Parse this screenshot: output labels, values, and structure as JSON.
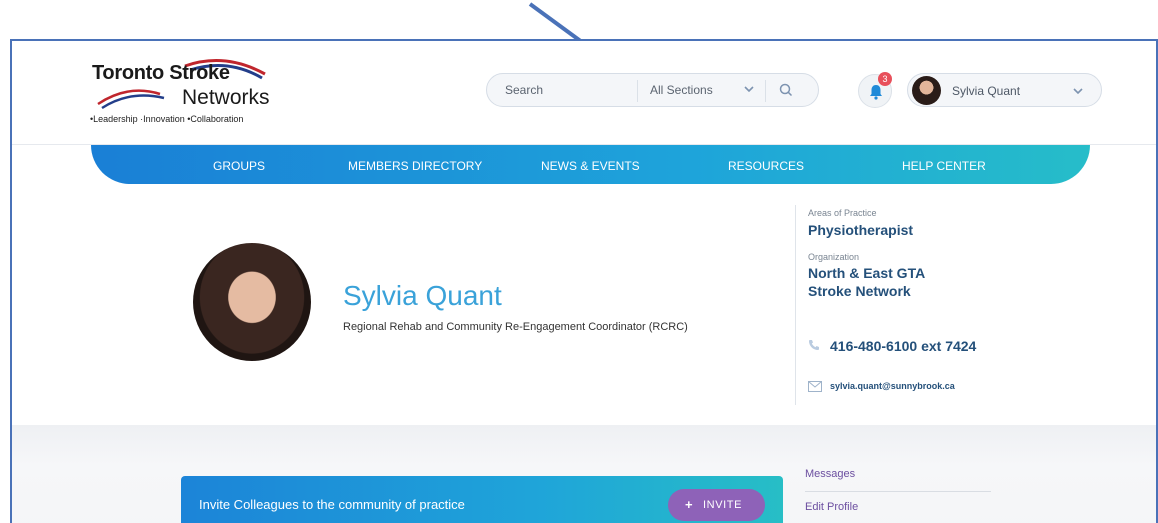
{
  "header": {
    "logo": {
      "line1": "Toronto Stroke",
      "line2": "Networks",
      "tagline": "•Leadership  ·Innovation  •Collaboration"
    },
    "search": {
      "placeholder": "Search",
      "section_value": "All Sections",
      "search_icon": "search-icon",
      "chevron_icon": "chevron-down-icon"
    },
    "notifications": {
      "icon": "bell-icon",
      "count": "3",
      "badge_color": "#e8505b"
    },
    "user": {
      "name": "Sylvia Quant",
      "chevron_icon": "chevron-down-icon"
    }
  },
  "nav": {
    "items": [
      {
        "label": "GROUPS"
      },
      {
        "label": "MEMBERS DIRECTORY"
      },
      {
        "label": "NEWS & EVENTS"
      },
      {
        "label": "RESOURCES"
      },
      {
        "label": "HELP CENTER"
      }
    ],
    "gradient_start": "#1a7fd6",
    "gradient_end": "#26bdc9"
  },
  "profile": {
    "name": "Sylvia Quant",
    "title": "Regional Rehab and Community Re-Engagement Coordinator (RCRC)",
    "name_color": "#3aa2d9",
    "areas_label": "Areas of Practice",
    "areas_value": "Physiotherapist",
    "org_label": "Organization",
    "org_line1": "North & East GTA",
    "org_line2": "Stroke Network",
    "phone": "416-480-6100 ext 7424",
    "email": "sylvia.quant@sunnybrook.ca",
    "phone_icon": "phone-icon",
    "mail_icon": "mail-icon"
  },
  "invite": {
    "text": "Invite Colleagues to the community of practice",
    "button_label": "INVITE",
    "button_icon": "plus-icon",
    "button_color": "#8e62b8"
  },
  "sidebar": {
    "links": [
      {
        "label": "Messages"
      },
      {
        "label": "Edit Profile"
      }
    ],
    "link_color": "#6c4fa0"
  },
  "annotation": {
    "arrow_color": "#4a72b8",
    "arrow_icon": "arrow-annotation-icon"
  }
}
